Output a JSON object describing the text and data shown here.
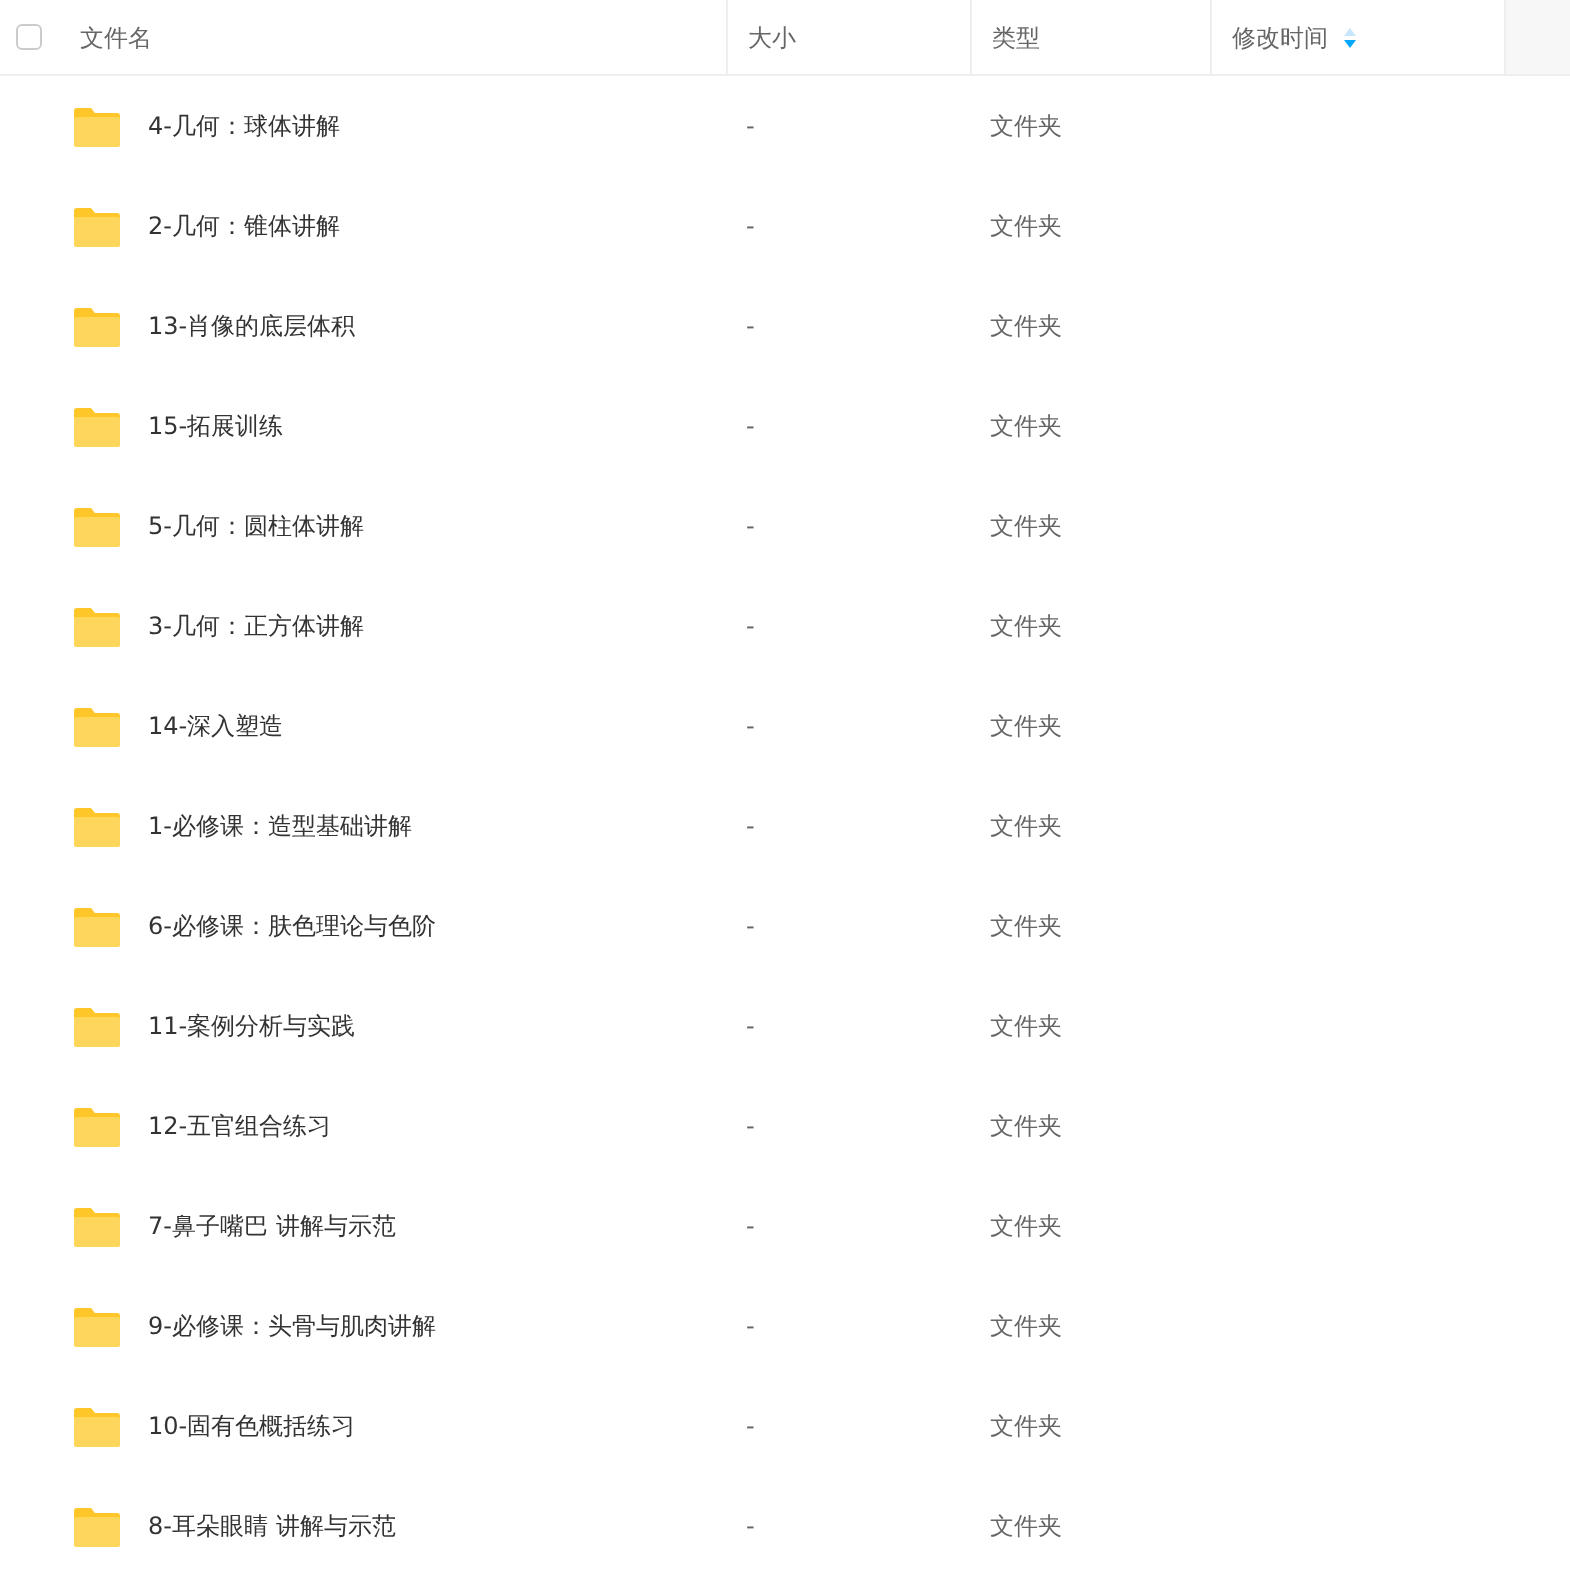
{
  "header": {
    "select_all": {
      "checked": false
    },
    "columns": [
      "文件名",
      "大小",
      "类型",
      "修改时间"
    ]
  },
  "rows": [
    {
      "name": "4-几何：球体讲解",
      "size": "-",
      "type": "文件夹"
    },
    {
      "name": "2-几何：锥体讲解",
      "size": "-",
      "type": "文件夹"
    },
    {
      "name": "13-肖像的底层体积",
      "size": "-",
      "type": "文件夹"
    },
    {
      "name": "15-拓展训练",
      "size": "-",
      "type": "文件夹"
    },
    {
      "name": "5-几何：圆柱体讲解",
      "size": "-",
      "type": "文件夹"
    },
    {
      "name": "3-几何：正方体讲解",
      "size": "-",
      "type": "文件夹"
    },
    {
      "name": "14-深入塑造",
      "size": "-",
      "type": "文件夹"
    },
    {
      "name": "1-必修课：造型基础讲解",
      "size": "-",
      "type": "文件夹"
    },
    {
      "name": "6-必修课：肤色理论与色阶",
      "size": "-",
      "type": "文件夹"
    },
    {
      "name": "11-案例分析与实践",
      "size": "-",
      "type": "文件夹"
    },
    {
      "name": "12-五官组合练习",
      "size": "-",
      "type": "文件夹"
    },
    {
      "name": "7-鼻子嘴巴 讲解与示范",
      "size": "-",
      "type": "文件夹"
    },
    {
      "name": "9-必修课：头骨与肌肉讲解",
      "size": "-",
      "type": "文件夹"
    },
    {
      "name": "10-固有色概括练习",
      "size": "-",
      "type": "文件夹"
    },
    {
      "name": "8-耳朵眼睛 讲解与示范",
      "size": "-",
      "type": "文件夹"
    }
  ]
}
